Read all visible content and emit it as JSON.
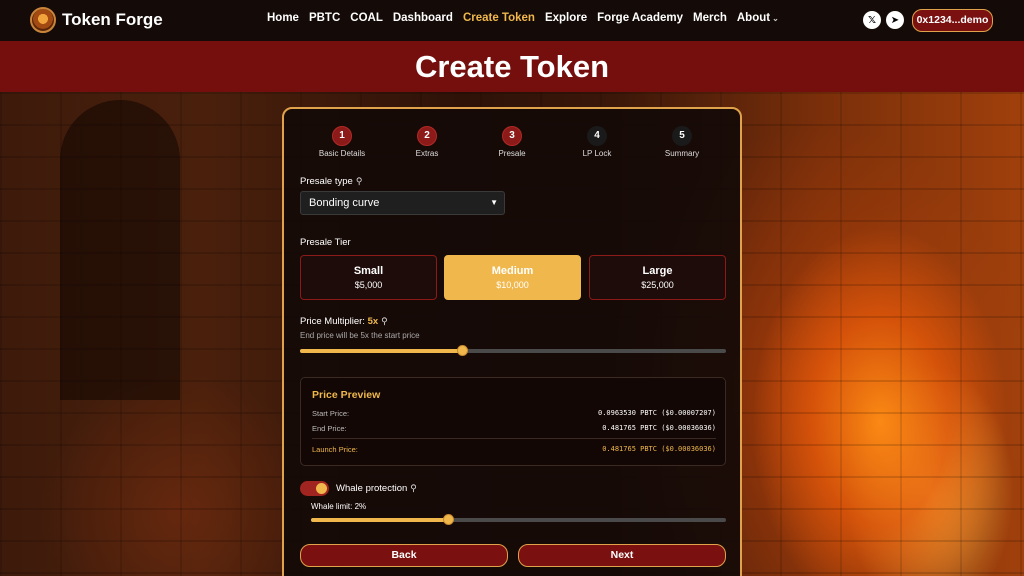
{
  "brand": {
    "name": "Token Forge",
    "logo_icon": "forge-logo-icon"
  },
  "nav": {
    "items": [
      {
        "label": "Home",
        "active": false
      },
      {
        "label": "PBTC",
        "active": false
      },
      {
        "label": "COAL",
        "active": false
      },
      {
        "label": "Dashboard",
        "active": false
      },
      {
        "label": "Create Token",
        "active": true
      },
      {
        "label": "Explore",
        "active": false
      },
      {
        "label": "Forge Academy",
        "active": false
      },
      {
        "label": "Merch",
        "active": false
      },
      {
        "label": "About",
        "active": false,
        "has_dropdown": true
      }
    ],
    "social": [
      {
        "icon": "x-icon",
        "glyph": "𝕏"
      },
      {
        "icon": "telegram-icon",
        "glyph": "➤"
      }
    ],
    "wallet_label": "0x1234...demo"
  },
  "header": {
    "title": "Create Token"
  },
  "steps": [
    {
      "number": "1",
      "label": "Basic Details",
      "status": "done"
    },
    {
      "number": "2",
      "label": "Extras",
      "status": "done"
    },
    {
      "number": "3",
      "label": "Presale",
      "status": "done"
    },
    {
      "number": "4",
      "label": "LP Lock",
      "status": "todo"
    },
    {
      "number": "5",
      "label": "Summary",
      "status": "todo"
    }
  ],
  "presale_type": {
    "label": "Presale type",
    "value": "Bonding curve"
  },
  "presale_tier": {
    "label": "Presale Tier",
    "options": [
      {
        "name": "Small",
        "price": "$5,000",
        "selected": false
      },
      {
        "name": "Medium",
        "price": "$10,000",
        "selected": true
      },
      {
        "name": "Large",
        "price": "$25,000",
        "selected": false
      }
    ]
  },
  "price_multiplier": {
    "label": "Price Multiplier:",
    "value": "5x",
    "hint": "End price will be 5x the start price",
    "slider_fraction": 0.38
  },
  "price_preview": {
    "title": "Price Preview",
    "start_label": "Start Price:",
    "start_value": "0.0963530 PBTC ($0.00007207)",
    "end_label": "End Price:",
    "end_value": "0.481765 PBTC ($0.00036036)",
    "launch_label": "Launch Price:",
    "launch_value": "0.481765 PBTC ($0.00036036)"
  },
  "whale_protection": {
    "label": "Whale protection",
    "enabled": true,
    "limit_label": "Whale limit: 2%",
    "slider_fraction": 0.33
  },
  "actions": {
    "back_label": "Back",
    "next_label": "Next"
  },
  "colors": {
    "accent": "#f0b84c",
    "brand_red": "#750f0e",
    "button_red": "#7a1010"
  }
}
